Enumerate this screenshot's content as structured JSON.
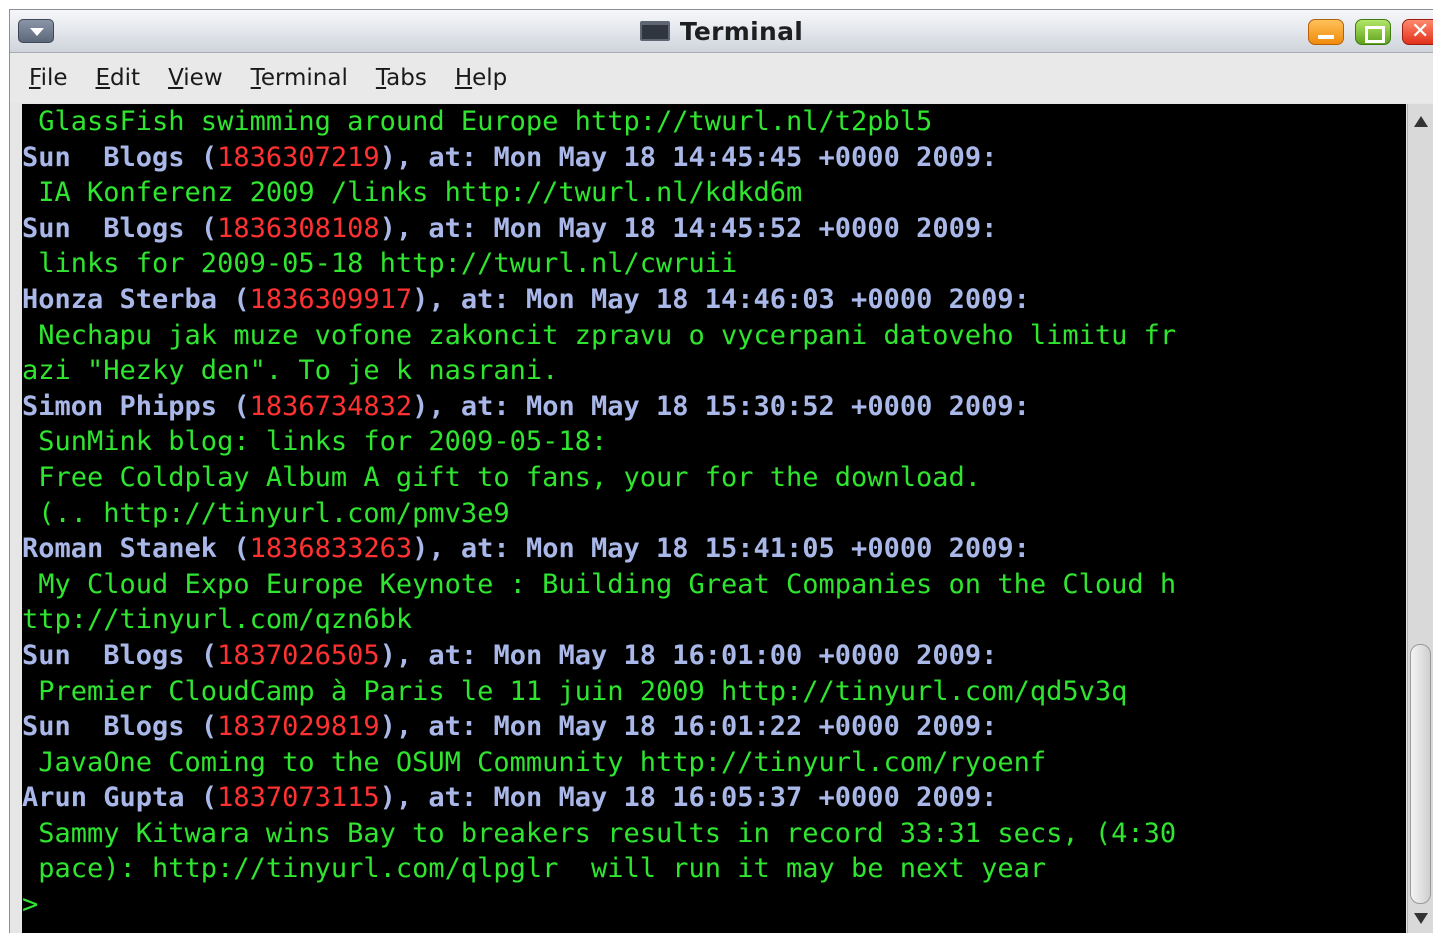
{
  "window": {
    "title": "Terminal",
    "icons": {
      "menu": "chevron-down-icon",
      "minimize": "minimize-icon",
      "maximize": "maximize-icon",
      "close": "close-icon",
      "app": "terminal-icon"
    },
    "close_glyph": "✕"
  },
  "menubar": {
    "items": [
      {
        "label": "File",
        "mnemonic": "F",
        "rest": "ile"
      },
      {
        "label": "Edit",
        "mnemonic": "E",
        "rest": "dit"
      },
      {
        "label": "View",
        "mnemonic": "V",
        "rest": "iew"
      },
      {
        "label": "Terminal",
        "mnemonic": "T",
        "rest": "erminal"
      },
      {
        "label": "Tabs",
        "mnemonic": "T",
        "rest": "abs"
      },
      {
        "label": "Help",
        "mnemonic": "H",
        "rest": "elp"
      }
    ]
  },
  "terminal": {
    "colors": {
      "text": "#2fe52f",
      "header": "#a9b8e8",
      "id": "#ff3131",
      "background": "#000000"
    },
    "lines": [
      {
        "kind": "text",
        "text": " GlassFish swimming around Europe http://twurl.nl/t2pbl5"
      },
      {
        "kind": "header",
        "name": "Sun  Blogs",
        "id": "1836307219",
        "date": "Mon May 18 14:45:45 +0000 2009"
      },
      {
        "kind": "text",
        "text": " IA Konferenz 2009 /links http://twurl.nl/kdkd6m"
      },
      {
        "kind": "header",
        "name": "Sun  Blogs",
        "id": "1836308108",
        "date": "Mon May 18 14:45:52 +0000 2009"
      },
      {
        "kind": "text",
        "text": " links for 2009-05-18 http://twurl.nl/cwruii"
      },
      {
        "kind": "header",
        "name": "Honza Sterba",
        "id": "1836309917",
        "date": "Mon May 18 14:46:03 +0000 2009"
      },
      {
        "kind": "text",
        "text": " Nechapu jak muze vofone zakoncit zpravu o vycerpani datoveho limitu fr"
      },
      {
        "kind": "text",
        "text": "azi \"Hezky den\". To je k nasrani."
      },
      {
        "kind": "header",
        "name": "Simon Phipps",
        "id": "1836734832",
        "date": "Mon May 18 15:30:52 +0000 2009"
      },
      {
        "kind": "text",
        "text": " SunMink blog: links for 2009-05-18:"
      },
      {
        "kind": "text",
        "text": " Free Coldplay Album A gift to fans, your for the download."
      },
      {
        "kind": "text",
        "text": " (.. http://tinyurl.com/pmv3e9"
      },
      {
        "kind": "header",
        "name": "Roman Stanek",
        "id": "1836833263",
        "date": "Mon May 18 15:41:05 +0000 2009"
      },
      {
        "kind": "text",
        "text": " My Cloud Expo Europe Keynote : Building Great Companies on the Cloud h"
      },
      {
        "kind": "text",
        "text": "ttp://tinyurl.com/qzn6bk"
      },
      {
        "kind": "header",
        "name": "Sun  Blogs",
        "id": "1837026505",
        "date": "Mon May 18 16:01:00 +0000 2009"
      },
      {
        "kind": "text",
        "text": " Premier CloudCamp à Paris le 11 juin 2009 http://tinyurl.com/qd5v3q"
      },
      {
        "kind": "header",
        "name": "Sun  Blogs",
        "id": "1837029819",
        "date": "Mon May 18 16:01:22 +0000 2009"
      },
      {
        "kind": "text",
        "text": " JavaOne Coming to the OSUM Community http://tinyurl.com/ryoenf"
      },
      {
        "kind": "header",
        "name": "Arun Gupta",
        "id": "1837073115",
        "date": "Mon May 18 16:05:37 +0000 2009"
      },
      {
        "kind": "text",
        "text": " Sammy Kitwara wins Bay to breakers results in record 33:31 secs, (4:30"
      },
      {
        "kind": "text",
        "text": " pace): http://tinyurl.com/qlpglr  will run it may be next year"
      }
    ],
    "prompt": ">"
  },
  "header_parts": {
    "open": " (",
    "close": "), at: ",
    "end": ":"
  },
  "scrollbar": {
    "position_fraction": 0.75,
    "icons": {
      "up": "arrow-up-icon",
      "down": "arrow-down-icon"
    }
  }
}
